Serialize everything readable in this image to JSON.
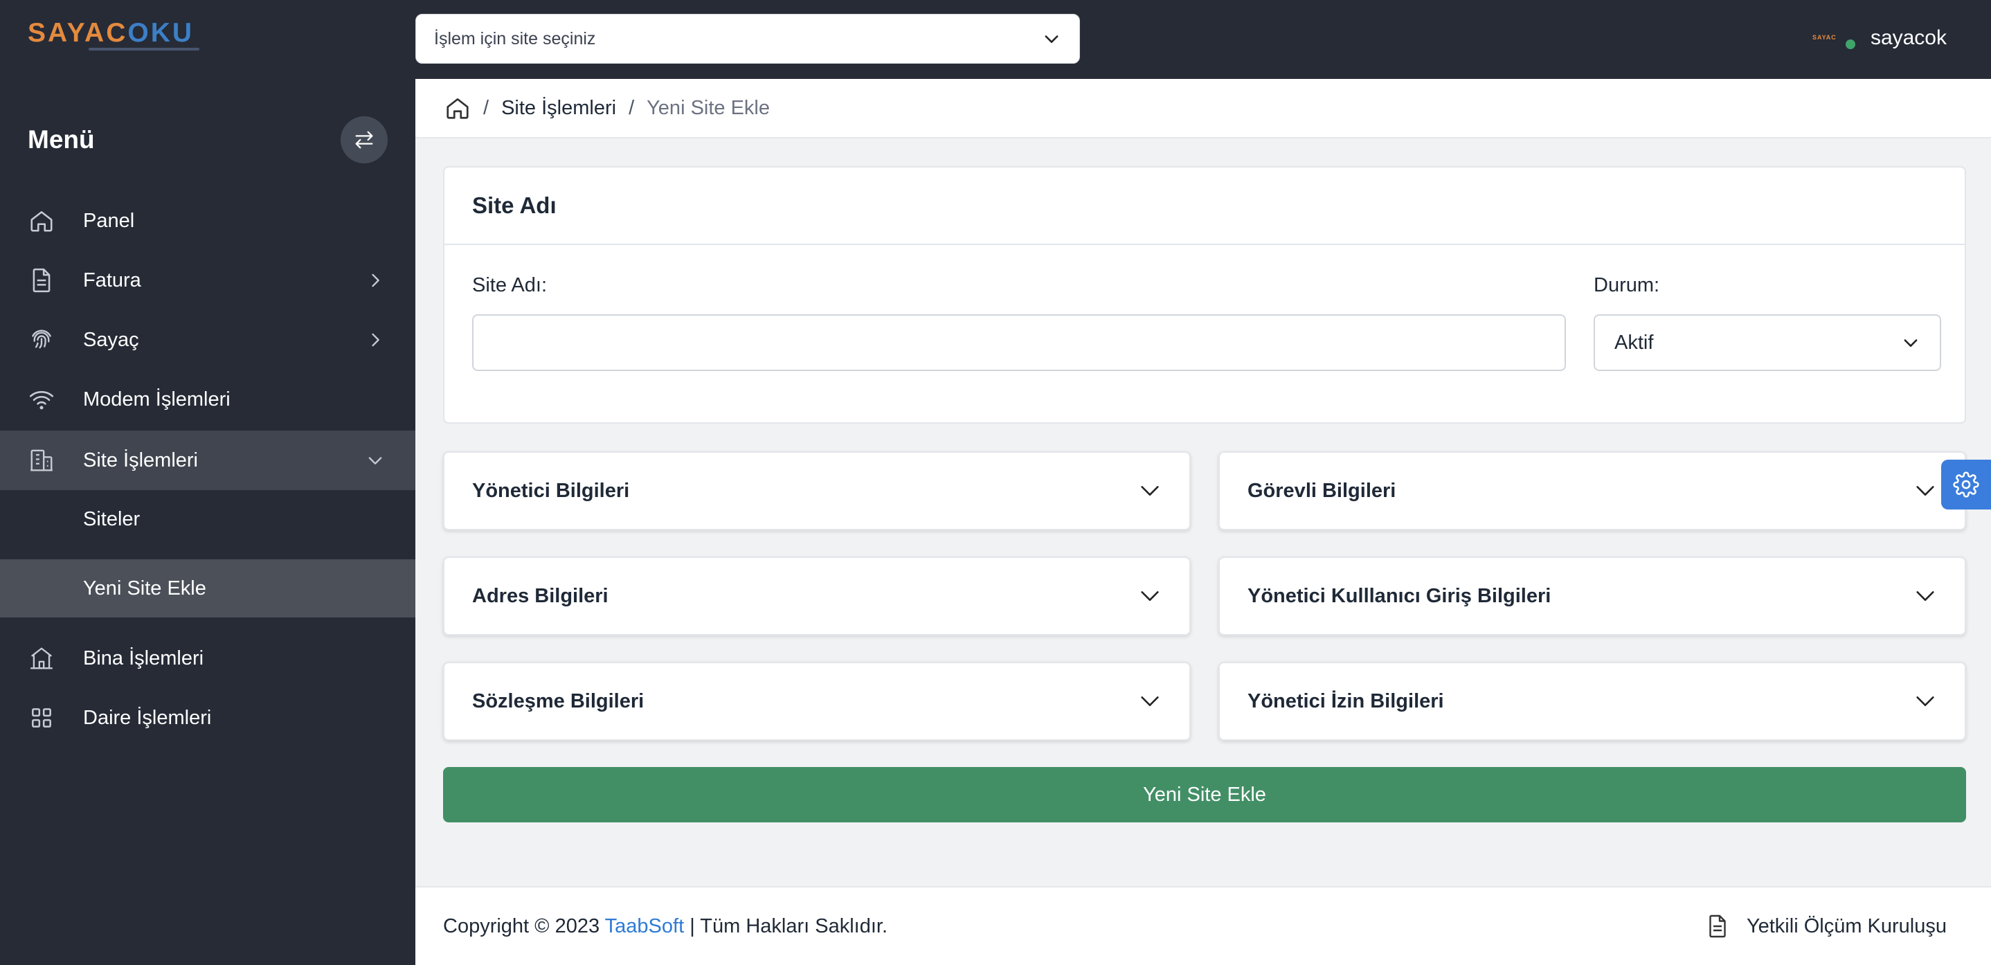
{
  "header": {
    "logo_part1": "SAYAC",
    "logo_part2": "OKU",
    "logo_mini": "SAYAC",
    "site_select_placeholder": "İşlem için site seçiniz",
    "username": "sayacok",
    "status_color": "#3fa56a"
  },
  "sidebar": {
    "title": "Menü",
    "toggle_icon": "arrows-swap-icon",
    "items": [
      {
        "label": "Panel",
        "icon": "home-icon"
      },
      {
        "label": "Fatura",
        "icon": "document-icon"
      },
      {
        "label": "Sayaç",
        "icon": "fingerprint-icon"
      },
      {
        "label": "Modem İşlemleri",
        "icon": "wifi-icon"
      },
      {
        "label": "Site İşlemleri",
        "icon": "building-icon"
      },
      {
        "label": "Bina İşlemleri",
        "icon": "house-icon"
      },
      {
        "label": "Daire İşlemleri",
        "icon": "grid-icon"
      }
    ],
    "subitems": [
      {
        "label": "Siteler"
      },
      {
        "label": "Yeni Site Ekle"
      }
    ]
  },
  "breadcrumb": {
    "items": [
      "Site İşlemleri",
      "Yeni Site Ekle"
    ]
  },
  "form": {
    "card_title": "Site Adı",
    "site_name_label": "Site Adı:",
    "site_name_value": "",
    "status_label": "Durum:",
    "status_value": "Aktif",
    "sections": [
      "Yönetici Bilgileri",
      "Görevli Bilgileri",
      "Adres Bilgileri",
      "Yönetici Kulllanıcı Giriş Bilgileri",
      "Sözleşme Bilgileri",
      "Yönetici İzin Bilgileri"
    ],
    "submit_label": "Yeni Site Ekle",
    "submit_color": "#428f66"
  },
  "footer": {
    "copyright_prefix": "Copyright © 2023 ",
    "brand": "TaabSoft",
    "copyright_suffix": " | Tüm Hakları Saklıdır.",
    "right_link": "Yetkili Ölçüm Kuruluşu",
    "brand_color": "#2f7ad6"
  }
}
